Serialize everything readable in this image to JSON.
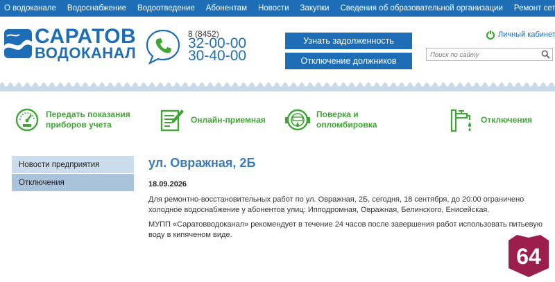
{
  "topnav": {
    "items": [
      "О водоканале",
      "Водоснабжение",
      "Водоотведение",
      "Абонентам",
      "Новости",
      "Закупки",
      "Сведения об образовательной организации",
      "Ремонт сетей"
    ]
  },
  "header": {
    "logo_line1": "САРАТОВ",
    "logo_line2": "ВОДОКАНАЛ",
    "phone_code": "8 (8452)",
    "phone_1": "32-00-00",
    "phone_2": "30-40-00",
    "btn_debt": "Узнать задолженность",
    "btn_off": "Отключение должников",
    "cabinet_label": "Личный кабинет",
    "search_placeholder": "Поиск по сайту"
  },
  "services": [
    {
      "label": "Передать показания\nприборов учета",
      "icon": "gauge-icon"
    },
    {
      "label": "Онлайн-приемная",
      "icon": "form-pencil-icon"
    },
    {
      "label": "Поверка и\nопломбировка",
      "icon": "water-meter-icon"
    },
    {
      "label": "Отключения",
      "icon": "faucet-icon"
    }
  ],
  "sidebar": {
    "items": [
      {
        "label": "Новости предприятия",
        "active": false
      },
      {
        "label": "Отключения",
        "active": true
      }
    ]
  },
  "article": {
    "title": "ул. Овражная, 2Б",
    "date": "18.09.2026",
    "paragraph_1": "Для ремонтно-восстановительных работ по ул. Овражная, 2Б, сегодня, 18 сентября, до 20:00 ограничено холодное водоснабжение у абонентов улиц: Ипподромная, Овражная, Белинского, Енисейская.",
    "paragraph_2": "МУПП «Саратовводоканал» рекомендует в течение 24 часов после завершения работ использовать питьевую воду в кипяченом виде."
  },
  "badge": {
    "text": "64"
  },
  "colors": {
    "brand_blue": "#1d6eb6",
    "service_green": "#3fa535",
    "sidebar_bg": "#cbdcec",
    "sidebar_active": "#a9c3dc",
    "badge": "#9b1f4a"
  }
}
